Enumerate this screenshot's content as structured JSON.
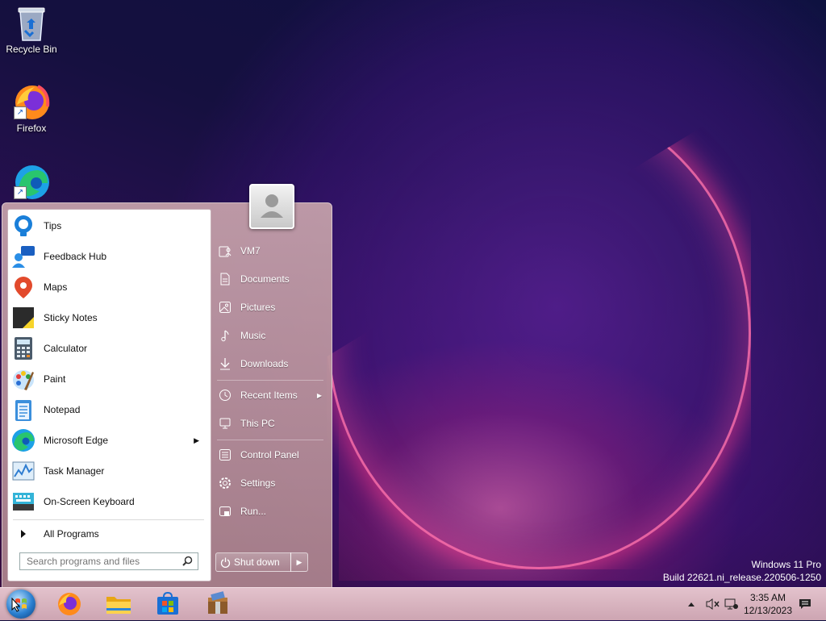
{
  "desktop": {
    "icons": [
      {
        "label": "Recycle Bin"
      },
      {
        "label": "Firefox"
      },
      {
        "label": ""
      }
    ],
    "watermark": {
      "line1": "Windows 11 Pro",
      "line2": "Build 22621.ni_release.220506-1250"
    }
  },
  "start_menu": {
    "programs": [
      {
        "label": "Tips",
        "icon": "tips-icon"
      },
      {
        "label": "Feedback Hub",
        "icon": "feedback-hub-icon"
      },
      {
        "label": "Maps",
        "icon": "maps-icon"
      },
      {
        "label": "Sticky Notes",
        "icon": "sticky-notes-icon"
      },
      {
        "label": "Calculator",
        "icon": "calculator-icon"
      },
      {
        "label": "Paint",
        "icon": "paint-icon"
      },
      {
        "label": "Notepad",
        "icon": "notepad-icon"
      },
      {
        "label": "Microsoft Edge",
        "icon": "edge-icon"
      },
      {
        "label": "Task Manager",
        "icon": "task-manager-icon"
      },
      {
        "label": "On-Screen Keyboard",
        "icon": "keyboard-icon"
      }
    ],
    "all_programs": "All Programs",
    "search_placeholder": "Search programs and files",
    "right": {
      "user": "VM7",
      "documents": "Documents",
      "pictures": "Pictures",
      "music": "Music",
      "downloads": "Downloads",
      "recent": "Recent Items",
      "this_pc": "This PC",
      "control_panel": "Control Panel",
      "settings": "Settings",
      "run": "Run..."
    },
    "shutdown": "Shut down"
  },
  "taskbar": {
    "time": "3:35 AM",
    "date": "12/13/2023"
  },
  "colors": {
    "accent_pink": "#ff5aa0",
    "taskbar_bg": "#d9b4c0"
  }
}
